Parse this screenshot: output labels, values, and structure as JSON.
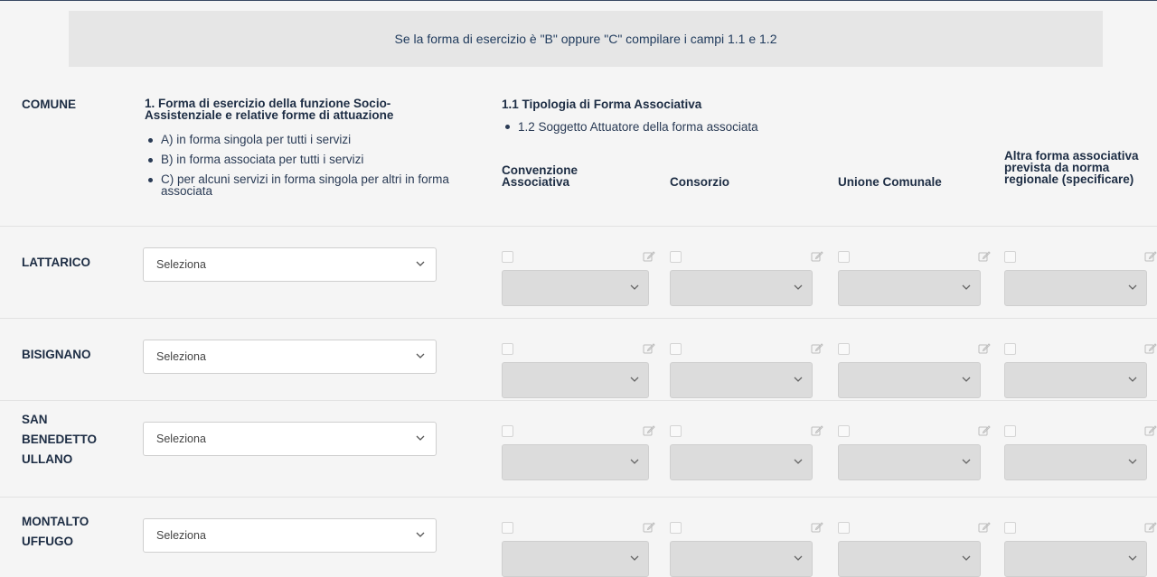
{
  "banner": {
    "text": "Se la forma di esercizio è \"B\" oppure \"C\" compilare i campi 1.1 e 1.2"
  },
  "header": {
    "comune": "COMUNE",
    "forma_title": "1. Forma di esercizio della funzione Socio-Assistenziale e relative forme di attuazione",
    "forma_options": [
      "A) in forma singola per tutti i servizi",
      "B) in forma associata per tutti i servizi",
      "C) per alcuni servizi in forma singola per altri in forma associata"
    ],
    "tipologia_title": "1.1 Tipologia di Forma Associativa",
    "soggetto": "1.2 Soggetto Attuatore della forma associata",
    "columns": [
      "Convenzione Associativa",
      "Consorzio",
      "Unione Comunale",
      "Altra forma associativa prevista da norma regionale (specificare)"
    ]
  },
  "rows": [
    {
      "name": "LATTARICO",
      "select": "Seleziona"
    },
    {
      "name": "BISIGNANO",
      "select": "Seleziona"
    },
    {
      "name": "SAN BENEDETTO ULLANO",
      "select": "Seleziona"
    },
    {
      "name": "MONTALTO UFFUGO",
      "select": "Seleziona"
    }
  ],
  "icons": {
    "checkbox": "checkbox-icon",
    "edit": "edit-icon",
    "dropdown": "chevron-down-icon"
  },
  "colors": {
    "accent": "#1f3a5c",
    "disabled_select": "#dcdcdc"
  }
}
